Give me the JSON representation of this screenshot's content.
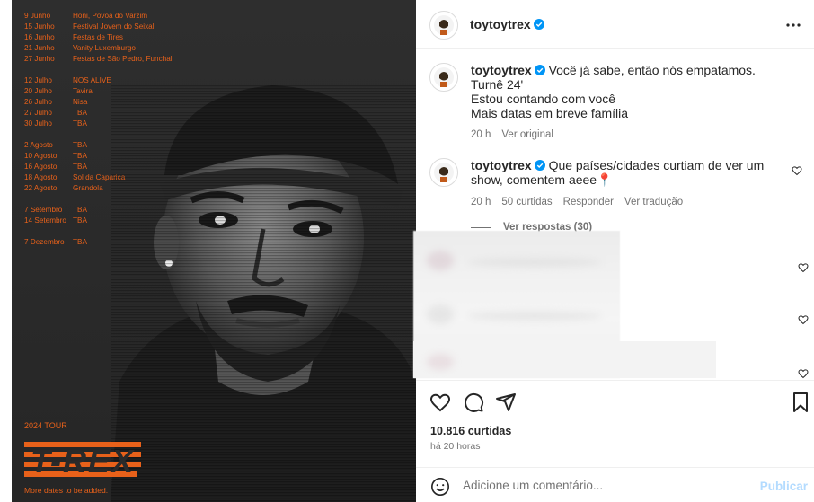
{
  "poster": {
    "tour_dates": [
      {
        "date": "9 Junho",
        "venue": "Honi, Povoa do Varzim"
      },
      {
        "date": "15 Junho",
        "venue": "Festival Jovem do Seixal"
      },
      {
        "date": "16 Junho",
        "venue": "Festas de Tires"
      },
      {
        "date": "21 Junho",
        "venue": "Vanity Luxemburgo"
      },
      {
        "date": "27 Junho",
        "venue": "Festas de São Pedro, Funchal"
      },
      {
        "date": "12 Julho",
        "venue": "NOS ALIVE"
      },
      {
        "date": "20 Julho",
        "venue": "Tavira"
      },
      {
        "date": "26 Julho",
        "venue": "Nisa"
      },
      {
        "date": "27 Julho",
        "venue": "TBA"
      },
      {
        "date": "30 Julho",
        "venue": "TBA"
      },
      {
        "date": "2 Agosto",
        "venue": "TBA"
      },
      {
        "date": "10 Agosto",
        "venue": "TBA"
      },
      {
        "date": "16 Agosto",
        "venue": "TBA"
      },
      {
        "date": "18 Agosto",
        "venue": "Sol da Caparica"
      },
      {
        "date": "22 Agosto",
        "venue": "Grandola"
      },
      {
        "date": "7 Setembro",
        "venue": "TBA"
      },
      {
        "date": "14 Setembro",
        "venue": "TBA"
      },
      {
        "date": "7 Dezembro",
        "venue": "TBA"
      }
    ],
    "tour_label": "2024 TOUR",
    "logo_text": "T-REX",
    "footer": "More dates to be added.",
    "accent_color": "#e8611a"
  },
  "header": {
    "username": "toytoytrex",
    "verified": true
  },
  "caption": {
    "username": "toytoytrex",
    "lines": [
      "Você já sabe, então nós empatamos.",
      "Turnê 24'",
      "Estou contando com você",
      "Mais datas em breve família"
    ],
    "time": "20 h",
    "see_original": "Ver original"
  },
  "pinned_comment": {
    "username": "toytoytrex",
    "text": "Que países/cidades curtiam de ver um show, comentem aeee📍",
    "time": "20 h",
    "likes": "50 curtidas",
    "reply": "Responder",
    "translate": "Ver tradução",
    "view_replies": "Ver respostas (30)"
  },
  "post": {
    "likes": "10.816 curtidas",
    "time": "há 20 horas"
  },
  "add_comment": {
    "placeholder": "Adicione um comentário...",
    "publish": "Publicar"
  }
}
